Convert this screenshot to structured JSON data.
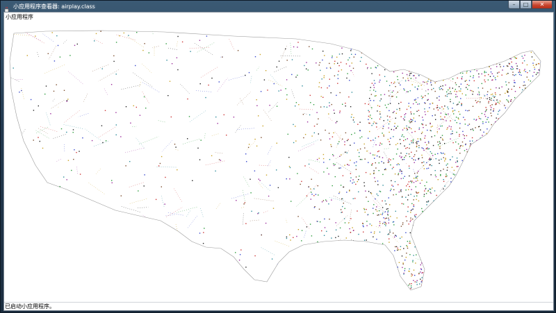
{
  "window": {
    "title": "小应用程序查看器: airplay.class",
    "icon": "java-cup-icon",
    "controls": {
      "minimize": "–",
      "maximize": "□",
      "close": "✕"
    }
  },
  "menu": {
    "applet_label": "小应用程序"
  },
  "status": {
    "text": "已启动小应用程序。"
  },
  "map": {
    "description_icon": "us-flight-routes-map",
    "colors": [
      "#cc3333",
      "#3344cc",
      "#2a9a3a",
      "#9a2a9a",
      "#c8a020",
      "#2a8a9a",
      "#222222",
      "#7a4a2a"
    ]
  }
}
